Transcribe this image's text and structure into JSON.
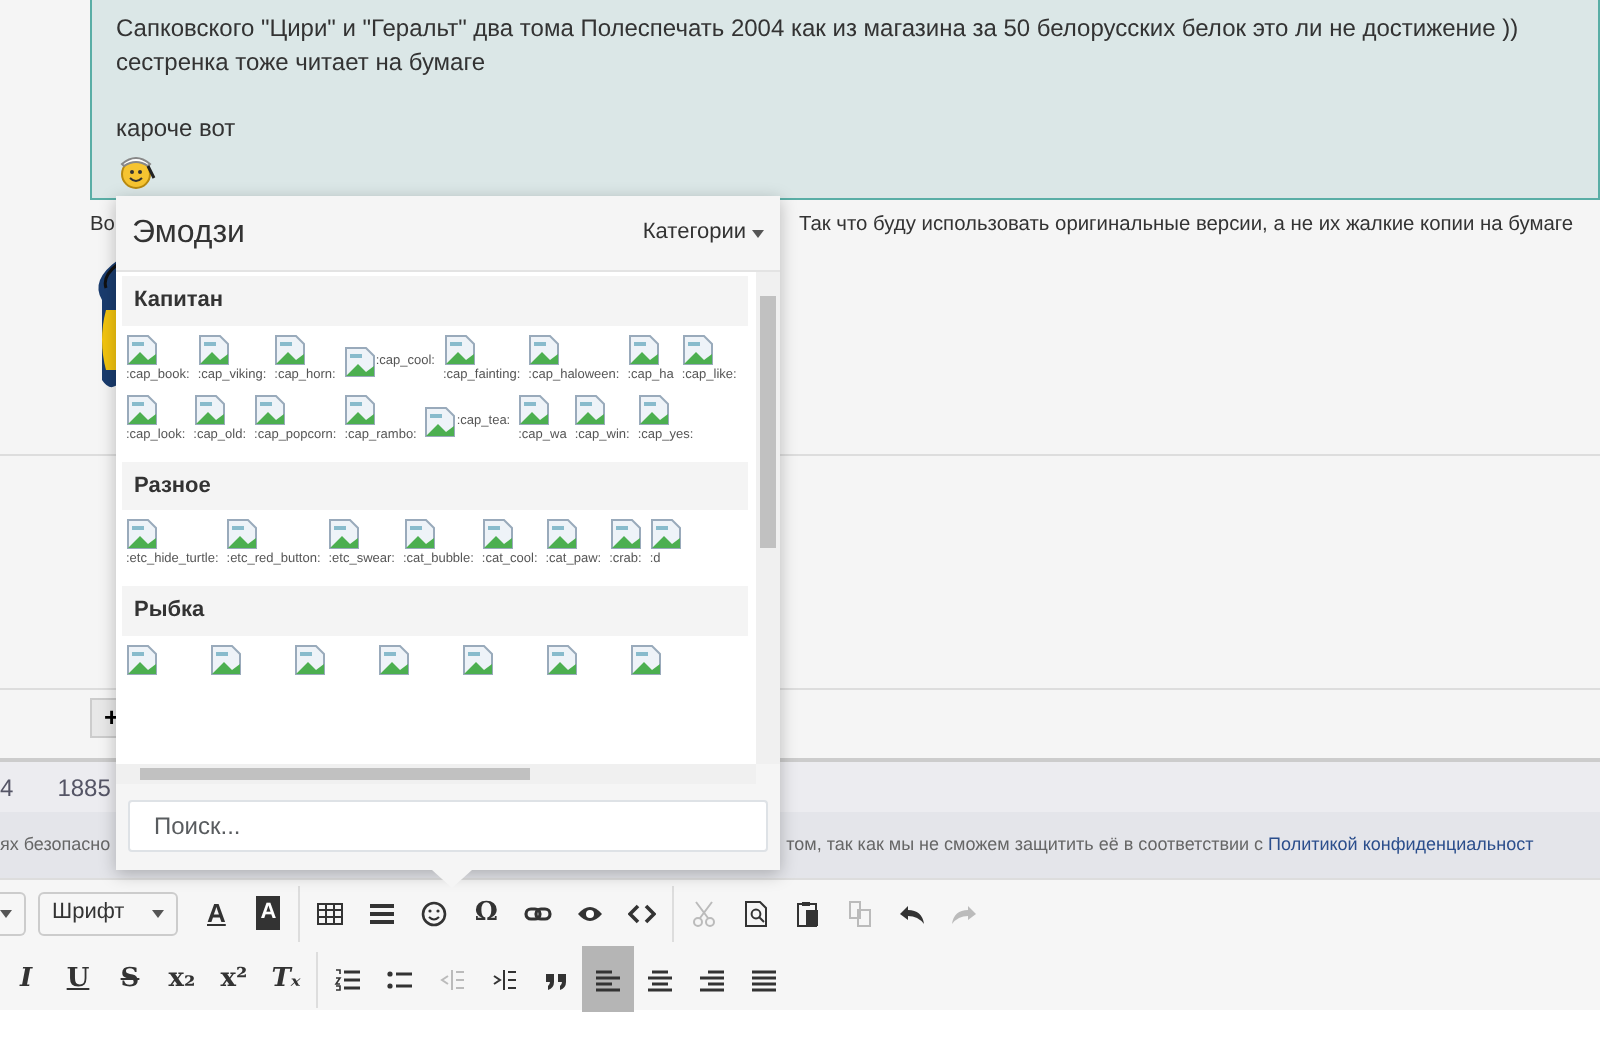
{
  "quote": {
    "paragraphs": [
      [
        "Сапковского \"Цири\" и \"Геральт\" два тома Полеспечать 2004 как из магазина за 50 белорусских белок это ли не достижение ))",
        "сестренка тоже читает на бумаге"
      ],
      [
        "кароче вот"
      ]
    ]
  },
  "post": {
    "text_start": "Во",
    "text_end": "Так что буду использовать оригинальные версии, а не их жалкие копии на бумаге"
  },
  "add_button": {
    "label": "+"
  },
  "stats": [
    "4",
    "1885"
  ],
  "notice": {
    "text_start": "ях безопасно",
    "text_end": "том, так как мы не сможем защитить её в соответствии с",
    "link": "Политикой конфиденциальност"
  },
  "emoji_picker": {
    "title": "Эмодзи",
    "categories_button": "Категории",
    "search": {
      "placeholder": "Поиск..."
    },
    "categories": [
      {
        "name": "Капитан",
        "items": [
          {
            "kind": "stacked",
            "label": ":cap_book:"
          },
          {
            "kind": "stacked",
            "label": ":cap_viking:"
          },
          {
            "kind": "stacked",
            "label": ":cap_horn:"
          },
          {
            "kind": "inline",
            "label": ":cap_cool:"
          },
          {
            "kind": "stacked",
            "label": ":cap_fainting:"
          },
          {
            "kind": "stacked",
            "label": ":cap_haloween:"
          },
          {
            "kind": "stacked",
            "label": ":cap_ha"
          },
          {
            "kind": "stacked",
            "label": ":cap_like:"
          },
          {
            "kind": "stacked",
            "label": ":cap_look:"
          },
          {
            "kind": "stacked",
            "label": ":cap_old:"
          },
          {
            "kind": "stacked",
            "label": ":cap_popcorn:"
          },
          {
            "kind": "stacked",
            "label": ":cap_rambo:"
          },
          {
            "kind": "inline",
            "label": ":cap_tea:"
          },
          {
            "kind": "stacked",
            "label": ":cap_wa"
          },
          {
            "kind": "stacked",
            "label": ":cap_win:"
          },
          {
            "kind": "stacked",
            "label": ":cap_yes:"
          }
        ]
      },
      {
        "name": "Разное",
        "items": [
          {
            "kind": "stacked",
            "label": ":etc_hide_turtle:"
          },
          {
            "kind": "stacked",
            "label": ":etc_red_button:"
          },
          {
            "kind": "stacked",
            "label": ":etc_swear:"
          },
          {
            "kind": "stacked",
            "label": ":cat_bubble:"
          },
          {
            "kind": "stacked",
            "label": ":cat_cool:"
          },
          {
            "kind": "stacked",
            "label": ":cat_paw:"
          },
          {
            "kind": "stacked",
            "label": ":crab:"
          },
          {
            "kind": "stacked",
            "label": ":d"
          }
        ]
      },
      {
        "name": "Рыбка",
        "items": [
          {
            "kind": "icon"
          },
          {
            "kind": "icon"
          },
          {
            "kind": "icon"
          },
          {
            "kind": "icon"
          },
          {
            "kind": "icon"
          },
          {
            "kind": "icon"
          },
          {
            "kind": "icon"
          }
        ]
      }
    ]
  },
  "toolbar": {
    "font_select": {
      "label": "Шрифт"
    },
    "row_1": [
      {
        "kind": "font-color",
        "label": "A",
        "disabled": false,
        "selected": false
      },
      {
        "kind": "bg-color",
        "label": "A",
        "disabled": false,
        "selected": false
      },
      {
        "kind": "sep"
      },
      {
        "kind": "table",
        "disabled": false,
        "selected": false
      },
      {
        "kind": "hr",
        "disabled": false,
        "selected": false
      },
      {
        "kind": "smiley",
        "disabled": false,
        "selected": false
      },
      {
        "kind": "char",
        "label": "Ω",
        "disabled": false,
        "selected": false
      },
      {
        "kind": "link",
        "disabled": false,
        "selected": false
      },
      {
        "kind": "eye",
        "disabled": false,
        "selected": false
      },
      {
        "kind": "code",
        "disabled": false,
        "selected": false
      },
      {
        "kind": "sep"
      },
      {
        "kind": "scissors",
        "disabled": true,
        "selected": false
      },
      {
        "kind": "find",
        "disabled": false,
        "selected": false
      },
      {
        "kind": "paste",
        "disabled": false,
        "selected": false
      },
      {
        "kind": "copy",
        "disabled": true,
        "selected": false
      },
      {
        "kind": "undo",
        "disabled": false,
        "selected": false
      },
      {
        "kind": "redo",
        "disabled": true,
        "selected": false
      }
    ],
    "row_2": [
      {
        "kind": "italic",
        "label": "I",
        "disabled": false,
        "selected": false
      },
      {
        "kind": "underline",
        "label": "U",
        "disabled": false,
        "selected": false
      },
      {
        "kind": "strike",
        "label": "S",
        "disabled": false,
        "selected": false
      },
      {
        "kind": "subscript",
        "label": "x₂",
        "disabled": false,
        "selected": false
      },
      {
        "kind": "superscript",
        "label": "x²",
        "disabled": false,
        "selected": false
      },
      {
        "kind": "clear-format",
        "label": "Tₓ",
        "disabled": false,
        "selected": false
      },
      {
        "kind": "sep"
      },
      {
        "kind": "ol",
        "disabled": false,
        "selected": false
      },
      {
        "kind": "ul",
        "disabled": false,
        "selected": false
      },
      {
        "kind": "outdent",
        "disabled": true,
        "selected": false
      },
      {
        "kind": "indent",
        "disabled": false,
        "selected": false
      },
      {
        "kind": "quote",
        "disabled": false,
        "selected": false
      },
      {
        "kind": "align-left",
        "disabled": false,
        "selected": true
      },
      {
        "kind": "align-center",
        "disabled": false,
        "selected": false
      },
      {
        "kind": "align-right",
        "disabled": false,
        "selected": false
      },
      {
        "kind": "justify",
        "disabled": false,
        "selected": false
      }
    ]
  }
}
